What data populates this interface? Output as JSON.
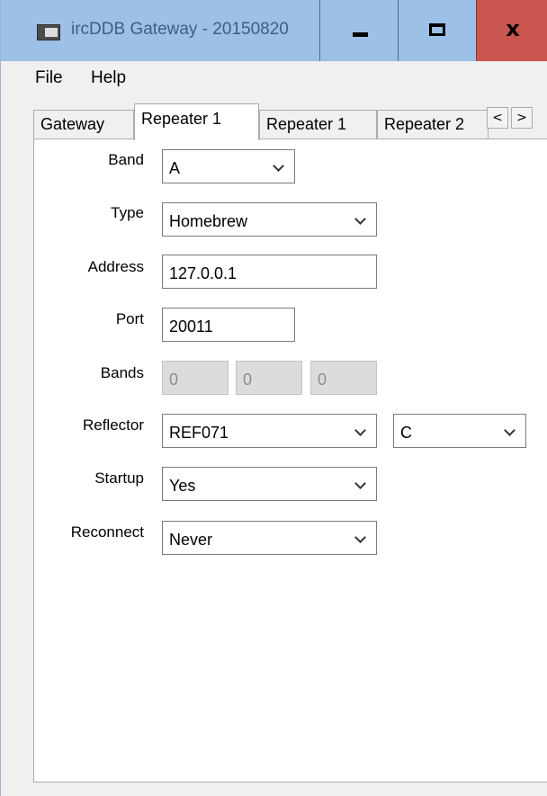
{
  "window": {
    "title": "ircDDB Gateway - 20150820"
  },
  "menu": {
    "file": "File",
    "help": "Help"
  },
  "tabs": [
    "Gateway",
    "Repeater 1",
    "Repeater 1",
    "Repeater 2"
  ],
  "tab_nav": {
    "left": "<",
    "right": ">"
  },
  "form": {
    "band": {
      "label": "Band",
      "value": "A"
    },
    "type": {
      "label": "Type",
      "value": "Homebrew"
    },
    "address": {
      "label": "Address",
      "value": "127.0.0.1"
    },
    "port": {
      "label": "Port",
      "value": "20011"
    },
    "bands": {
      "label": "Bands",
      "values": [
        "0",
        "0",
        "0"
      ]
    },
    "reflector": {
      "label": "Reflector",
      "value": "REF071",
      "module": "C"
    },
    "startup": {
      "label": "Startup",
      "value": "Yes"
    },
    "reconnect": {
      "label": "Reconnect",
      "value": "Never"
    }
  },
  "colors": {
    "titlebar": "#9cc0e6",
    "close": "#c9564e",
    "title_text": "#3d5f86"
  }
}
